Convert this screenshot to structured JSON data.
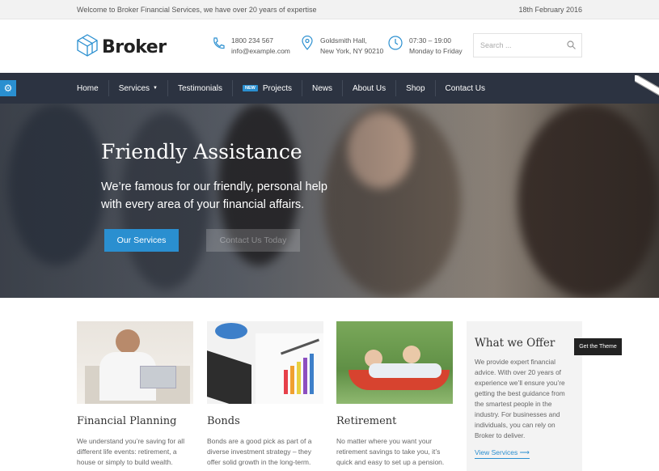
{
  "topbar": {
    "welcome": "Welcome to Broker Financial Services, we have over 20 years of expertise",
    "date": "18th February 2016"
  },
  "header": {
    "logo_text": "Broker",
    "phone": "1800 234 567",
    "email": "info@example.com",
    "address_line1": "Goldsmith Hall,",
    "address_line2": "New York, NY 90210",
    "hours_line1": "07:30 – 19:00",
    "hours_line2": "Monday to Friday",
    "search_placeholder": "Search ..."
  },
  "nav": {
    "items": [
      {
        "label": "Home"
      },
      {
        "label": "Services"
      },
      {
        "label": "Testimonials"
      },
      {
        "label": "Projects",
        "badge": "NEW"
      },
      {
        "label": "News"
      },
      {
        "label": "About Us"
      },
      {
        "label": "Shop"
      },
      {
        "label": "Contact Us"
      }
    ]
  },
  "hero": {
    "title": "Friendly Assistance",
    "subtitle": "We’re famous for our friendly, personal help with every area of your financial affairs.",
    "primary_button": "Our Services",
    "secondary_button": "Contact Us Today"
  },
  "cards": [
    {
      "title": "Financial Planning",
      "text": "We understand you’re saving for all different life events: retirement, a house or simply to build wealth."
    },
    {
      "title": "Bonds",
      "text": "Bonds are a good pick as part of a diverse investment strategy – they offer solid growth in the long-term."
    },
    {
      "title": "Retirement",
      "text": "No matter where you want your retirement savings to take you, it’s quick and easy to set up a pension."
    }
  ],
  "offer": {
    "title": "What we Offer",
    "text": "We provide expert financial advice. With over 20 years of experience we’ll ensure you’re getting the best guidance from the smartest people in the industry. For businesses and individuals, you can rely on Broker to deliver.",
    "link": "View Services ⟶"
  },
  "get_theme": "Get the Theme",
  "colors": {
    "accent": "#2a8fd0",
    "nav_bg": "#2c3341",
    "topbar_bg": "#f2f2f2"
  }
}
